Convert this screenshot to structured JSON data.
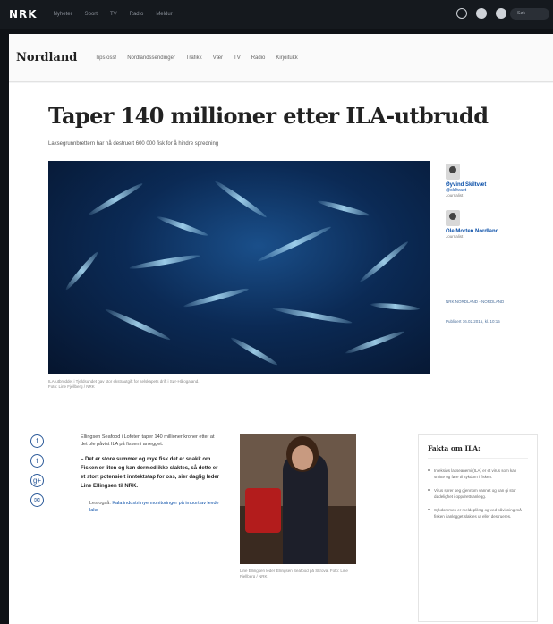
{
  "topbar": {
    "logo": "NRK",
    "nav": [
      "Nyheter",
      "Sport",
      "TV",
      "Radio",
      "Meldur"
    ],
    "search_placeholder": "Søk"
  },
  "subnav": {
    "region": "Nordland",
    "items": [
      "Tips oss!",
      "Nordlandssendinger",
      "Trafikk",
      "Vær",
      "TV",
      "Radio",
      "Kirjoitukk"
    ]
  },
  "article": {
    "headline": "Taper 140 millioner etter ILA-utbrudd",
    "lead": "Laksegrunnbrettern har nå destruert 600 000 fisk for å hindre spredning",
    "image_caption_line1": "ILA-utbruddet i Tjeldsundet gav stor ekstrautgift for selskapets drift i Sør-Hålogaland.",
    "image_caption_line2": "Foto: Line Fjellberg / NRK"
  },
  "authors": [
    {
      "name": "Øyvind Skiltvæt",
      "handle": "@skiltvaet",
      "role": "Journalist"
    },
    {
      "name": "Ole Morten Nordland",
      "handle": "",
      "role": "Journalist"
    }
  ],
  "meta": {
    "section": "NRK NORDLAND - NORDLAND",
    "published": "Publisert 16.02.2015, kl. 10:15"
  },
  "share": [
    "f",
    "t",
    "g+",
    "✉"
  ],
  "body": {
    "intro": "Ellingsen Seafood i Lofoten taper 140 millioner kroner etter at det ble påvist ILA på fisken i anlegget.",
    "quote": "– Det er store summer og mye fisk det er snakk om. Fisken er liten og kan dermed ikke slaktes, så dette er et stort potensielt inntektstap for oss, sier daglig leder Line Ellingsen til NRK.",
    "read_also_prefix": "Les også:",
    "read_also_link": "Kala industri nye monitoringer på import av levde laks"
  },
  "inline_photo_caption": "Line Ellingsen leder Ellingsen Seafood på Skrova. Foto: Line Fjellberg / NRK",
  "facts": {
    "title": "Fakta om ILA:",
    "items": [
      "Infeksiøs lakseanemi (ILA) er et virus som kan smitte og føre til sykdom i fisken.",
      "Virus sprer seg gjennom vannet og kan gi stor dødelighet i oppdrettsanlegg.",
      "Sykdommen er meldepliktig og ved påvisning må fisken i anlegget slaktes ut eller destrueres."
    ]
  }
}
